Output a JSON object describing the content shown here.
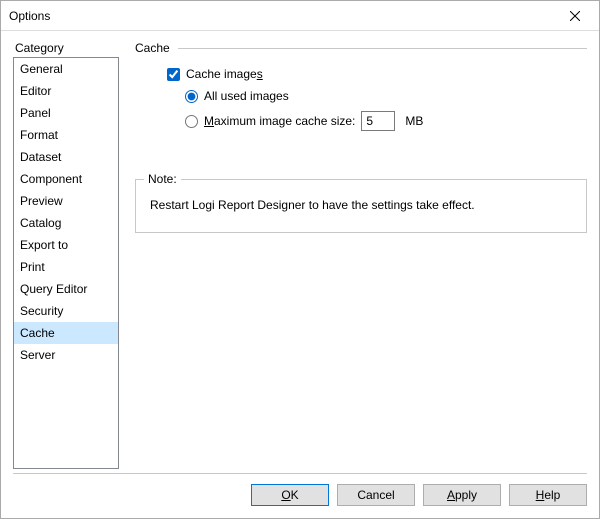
{
  "window": {
    "title": "Options"
  },
  "sidebar": {
    "label": "Category",
    "items": [
      {
        "label": "General"
      },
      {
        "label": "Editor"
      },
      {
        "label": "Panel"
      },
      {
        "label": "Format"
      },
      {
        "label": "Dataset"
      },
      {
        "label": "Component"
      },
      {
        "label": "Preview"
      },
      {
        "label": "Catalog"
      },
      {
        "label": "Export to"
      },
      {
        "label": "Print"
      },
      {
        "label": "Query Editor"
      },
      {
        "label": "Security"
      },
      {
        "label": "Cache"
      },
      {
        "label": "Server"
      }
    ],
    "selected_index": 12
  },
  "main": {
    "section_title": "Cache",
    "cache_images": {
      "prefix": "Cache image",
      "accel": "s",
      "suffix": "",
      "checked": true
    },
    "radio": {
      "all_used": {
        "label": "All used images",
        "checked": true
      },
      "max_size": {
        "prefix": "",
        "accel": "M",
        "suffix": "aximum image cache size:",
        "checked": false,
        "value": "5",
        "unit": "MB"
      }
    },
    "note": {
      "legend": "Note:",
      "text": "Restart Logi Report Designer to have the settings take effect."
    }
  },
  "footer": {
    "ok": {
      "prefix": "",
      "accel": "O",
      "suffix": "K"
    },
    "cancel": {
      "label": "Cancel"
    },
    "apply": {
      "prefix": "",
      "accel": "A",
      "suffix": "pply"
    },
    "help": {
      "prefix": "",
      "accel": "H",
      "suffix": "elp"
    }
  }
}
